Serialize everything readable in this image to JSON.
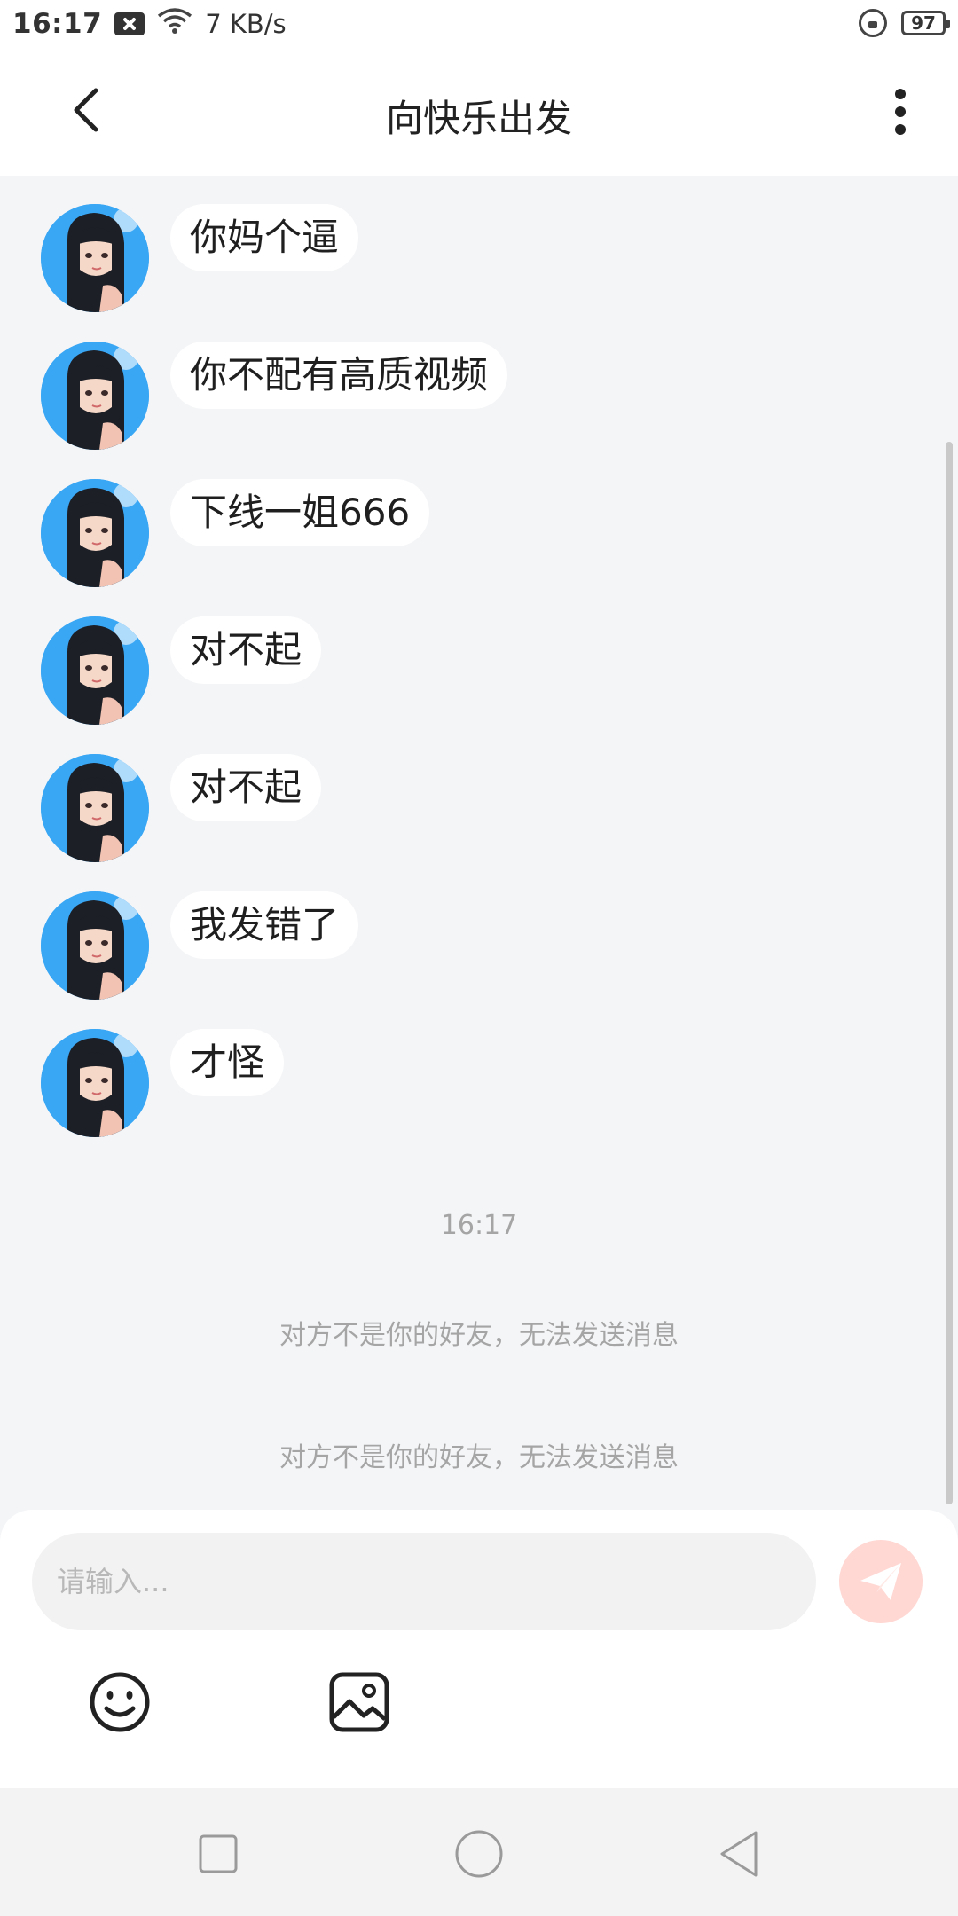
{
  "status_bar": {
    "time": "16:17",
    "network_speed": "7 KB/s",
    "battery": "97",
    "icons": [
      "close-box-icon",
      "wifi-icon",
      "rotation-lock-icon",
      "battery-icon"
    ]
  },
  "header": {
    "title": "向快乐出发",
    "back_icon": "chevron-left-icon",
    "menu_icon": "more-vertical-icon"
  },
  "messages": [
    {
      "text": "你妈个逼"
    },
    {
      "text": "你不配有高质视频"
    },
    {
      "text": "下线一姐666"
    },
    {
      "text": "对不起"
    },
    {
      "text": "对不起"
    },
    {
      "text": "我发错了"
    },
    {
      "text": "才怪"
    }
  ],
  "timestamp": "16:17",
  "system_notices": [
    "对方不是你的好友，无法发送消息",
    "对方不是你的好友，无法发送消息"
  ],
  "composer": {
    "placeholder": "请输入...",
    "value": "",
    "send_icon": "send-icon",
    "emoji_icon": "emoji-icon",
    "image_icon": "image-icon"
  },
  "colors": {
    "send_button": "#ffd7d3",
    "chat_background": "#f4f5f7",
    "avatar_sky": "#3aa7f5"
  }
}
